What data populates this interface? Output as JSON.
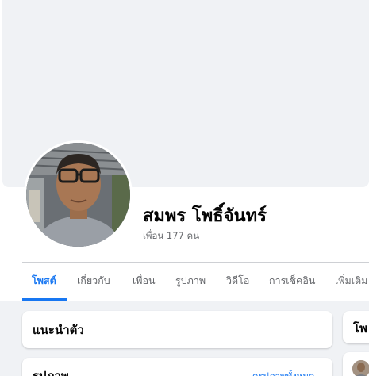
{
  "profile": {
    "name": "สมพร โพธิ์จันทร์",
    "friends": "เพื่อน 177 คน"
  },
  "tabs": [
    {
      "label": "โพสต์",
      "active": true
    },
    {
      "label": "เกี่ยวกับ",
      "active": false
    },
    {
      "label": "เพื่อน",
      "active": false
    },
    {
      "label": "รูปภาพ",
      "active": false
    },
    {
      "label": "วิดีโอ",
      "active": false
    },
    {
      "label": "การเช็คอิน",
      "active": false
    },
    {
      "label": "เพิ่มเติม",
      "active": false
    }
  ],
  "intro_card": {
    "title": "แนะนำตัว"
  },
  "photos_card": {
    "title": "รูปภาพ",
    "see_all": "ดูรูปภาพทั้งหมด"
  },
  "post_card": {
    "title": "โพ"
  },
  "colors": {
    "accent": "#1877f2",
    "cover": "#f0f2f5",
    "text_primary": "#050505",
    "text_secondary": "#65676b"
  }
}
